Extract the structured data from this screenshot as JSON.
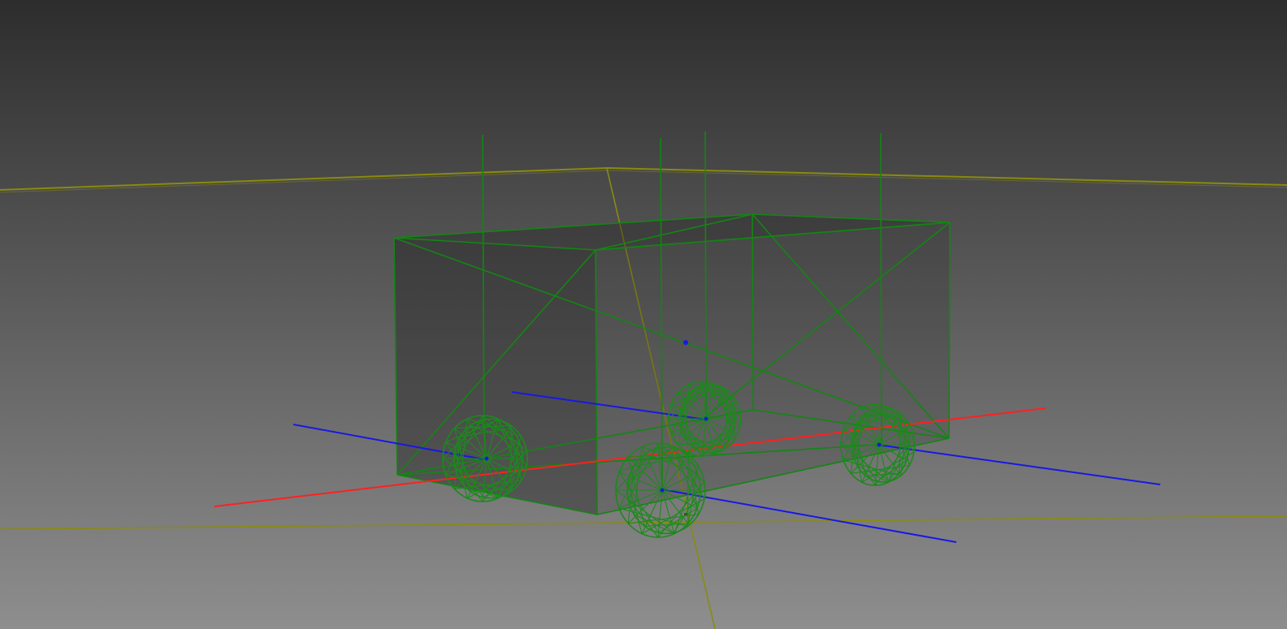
{
  "viewport": {
    "background_top": "#2d2d2d",
    "background_bottom": "#8e8e8e"
  },
  "colors": {
    "ground_grid": "#8a8a10",
    "chassis_wire": "#128612",
    "wheel_wire": "#1b8a1b",
    "axis_x": "#ff2020",
    "axis_z": "#1818e6",
    "body_fill": "#1e1e1e"
  },
  "scene": {
    "object": "wireframe-vehicle",
    "wheel_count": 4,
    "has_suspension_lines": true,
    "has_ground_grid": true
  }
}
